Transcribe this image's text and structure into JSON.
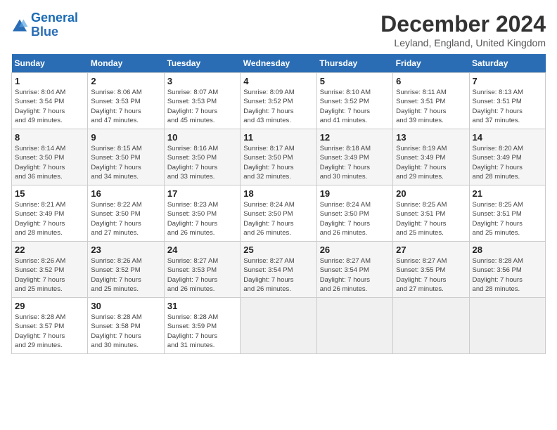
{
  "header": {
    "logo_line1": "General",
    "logo_line2": "Blue",
    "title": "December 2024",
    "location": "Leyland, England, United Kingdom"
  },
  "calendar": {
    "days_of_week": [
      "Sunday",
      "Monday",
      "Tuesday",
      "Wednesday",
      "Thursday",
      "Friday",
      "Saturday"
    ],
    "weeks": [
      [
        {
          "num": "",
          "info": ""
        },
        {
          "num": "2",
          "info": "Sunrise: 8:06 AM\nSunset: 3:53 PM\nDaylight: 7 hours\nand 47 minutes."
        },
        {
          "num": "3",
          "info": "Sunrise: 8:07 AM\nSunset: 3:53 PM\nDaylight: 7 hours\nand 45 minutes."
        },
        {
          "num": "4",
          "info": "Sunrise: 8:09 AM\nSunset: 3:52 PM\nDaylight: 7 hours\nand 43 minutes."
        },
        {
          "num": "5",
          "info": "Sunrise: 8:10 AM\nSunset: 3:52 PM\nDaylight: 7 hours\nand 41 minutes."
        },
        {
          "num": "6",
          "info": "Sunrise: 8:11 AM\nSunset: 3:51 PM\nDaylight: 7 hours\nand 39 minutes."
        },
        {
          "num": "7",
          "info": "Sunrise: 8:13 AM\nSunset: 3:51 PM\nDaylight: 7 hours\nand 37 minutes."
        }
      ],
      [
        {
          "num": "1",
          "info": "Sunrise: 8:04 AM\nSunset: 3:54 PM\nDaylight: 7 hours\nand 49 minutes."
        },
        {
          "num": "",
          "info": ""
        },
        {
          "num": "",
          "info": ""
        },
        {
          "num": "",
          "info": ""
        },
        {
          "num": "",
          "info": ""
        },
        {
          "num": "",
          "info": ""
        },
        {
          "num": "",
          "info": ""
        }
      ],
      [
        {
          "num": "8",
          "info": "Sunrise: 8:14 AM\nSunset: 3:50 PM\nDaylight: 7 hours\nand 36 minutes."
        },
        {
          "num": "9",
          "info": "Sunrise: 8:15 AM\nSunset: 3:50 PM\nDaylight: 7 hours\nand 34 minutes."
        },
        {
          "num": "10",
          "info": "Sunrise: 8:16 AM\nSunset: 3:50 PM\nDaylight: 7 hours\nand 33 minutes."
        },
        {
          "num": "11",
          "info": "Sunrise: 8:17 AM\nSunset: 3:50 PM\nDaylight: 7 hours\nand 32 minutes."
        },
        {
          "num": "12",
          "info": "Sunrise: 8:18 AM\nSunset: 3:49 PM\nDaylight: 7 hours\nand 30 minutes."
        },
        {
          "num": "13",
          "info": "Sunrise: 8:19 AM\nSunset: 3:49 PM\nDaylight: 7 hours\nand 29 minutes."
        },
        {
          "num": "14",
          "info": "Sunrise: 8:20 AM\nSunset: 3:49 PM\nDaylight: 7 hours\nand 28 minutes."
        }
      ],
      [
        {
          "num": "15",
          "info": "Sunrise: 8:21 AM\nSunset: 3:49 PM\nDaylight: 7 hours\nand 28 minutes."
        },
        {
          "num": "16",
          "info": "Sunrise: 8:22 AM\nSunset: 3:50 PM\nDaylight: 7 hours\nand 27 minutes."
        },
        {
          "num": "17",
          "info": "Sunrise: 8:23 AM\nSunset: 3:50 PM\nDaylight: 7 hours\nand 26 minutes."
        },
        {
          "num": "18",
          "info": "Sunrise: 8:24 AM\nSunset: 3:50 PM\nDaylight: 7 hours\nand 26 minutes."
        },
        {
          "num": "19",
          "info": "Sunrise: 8:24 AM\nSunset: 3:50 PM\nDaylight: 7 hours\nand 26 minutes."
        },
        {
          "num": "20",
          "info": "Sunrise: 8:25 AM\nSunset: 3:51 PM\nDaylight: 7 hours\nand 25 minutes."
        },
        {
          "num": "21",
          "info": "Sunrise: 8:25 AM\nSunset: 3:51 PM\nDaylight: 7 hours\nand 25 minutes."
        }
      ],
      [
        {
          "num": "22",
          "info": "Sunrise: 8:26 AM\nSunset: 3:52 PM\nDaylight: 7 hours\nand 25 minutes."
        },
        {
          "num": "23",
          "info": "Sunrise: 8:26 AM\nSunset: 3:52 PM\nDaylight: 7 hours\nand 25 minutes."
        },
        {
          "num": "24",
          "info": "Sunrise: 8:27 AM\nSunset: 3:53 PM\nDaylight: 7 hours\nand 26 minutes."
        },
        {
          "num": "25",
          "info": "Sunrise: 8:27 AM\nSunset: 3:54 PM\nDaylight: 7 hours\nand 26 minutes."
        },
        {
          "num": "26",
          "info": "Sunrise: 8:27 AM\nSunset: 3:54 PM\nDaylight: 7 hours\nand 26 minutes."
        },
        {
          "num": "27",
          "info": "Sunrise: 8:27 AM\nSunset: 3:55 PM\nDaylight: 7 hours\nand 27 minutes."
        },
        {
          "num": "28",
          "info": "Sunrise: 8:28 AM\nSunset: 3:56 PM\nDaylight: 7 hours\nand 28 minutes."
        }
      ],
      [
        {
          "num": "29",
          "info": "Sunrise: 8:28 AM\nSunset: 3:57 PM\nDaylight: 7 hours\nand 29 minutes."
        },
        {
          "num": "30",
          "info": "Sunrise: 8:28 AM\nSunset: 3:58 PM\nDaylight: 7 hours\nand 30 minutes."
        },
        {
          "num": "31",
          "info": "Sunrise: 8:28 AM\nSunset: 3:59 PM\nDaylight: 7 hours\nand 31 minutes."
        },
        {
          "num": "",
          "info": ""
        },
        {
          "num": "",
          "info": ""
        },
        {
          "num": "",
          "info": ""
        },
        {
          "num": "",
          "info": ""
        }
      ]
    ]
  }
}
